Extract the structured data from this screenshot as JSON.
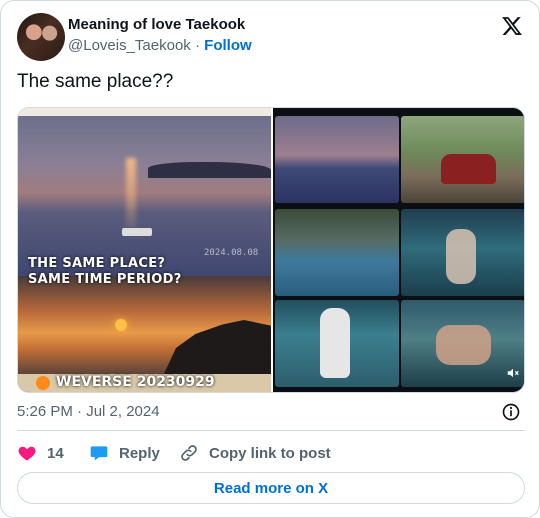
{
  "author": {
    "name": "Meaning of love Taekook",
    "handle": "@Loveis_Taekook",
    "separator": "·",
    "follow_label": "Follow"
  },
  "tweet": {
    "text": "The same place??"
  },
  "media": {
    "left_overlay_line1": "THE SAME PLACE?",
    "left_overlay_line2": "SAME TIME PERIOD?",
    "left_date_stamp": "2024.08.08",
    "weverse_label": "WEVERSE 20230929"
  },
  "meta": {
    "timestamp": "5:26 PM · Jul 2, 2024"
  },
  "actions": {
    "like_count": "14",
    "reply_label": "Reply",
    "copy_label": "Copy link to post"
  },
  "footer": {
    "read_more_label": "Read more on X"
  },
  "colors": {
    "link_blue": "#006fd6",
    "heart_pink": "#f91880",
    "reply_blue": "#1d9bf0",
    "text_primary": "#0f1419",
    "text_secondary": "#536471",
    "border": "#cfd9de"
  },
  "icons": {
    "brand": "x-logo-icon",
    "like": "heart-icon",
    "reply": "speech-bubble-icon",
    "copy": "link-icon",
    "info": "info-icon",
    "mute": "muted-speaker-icon"
  }
}
